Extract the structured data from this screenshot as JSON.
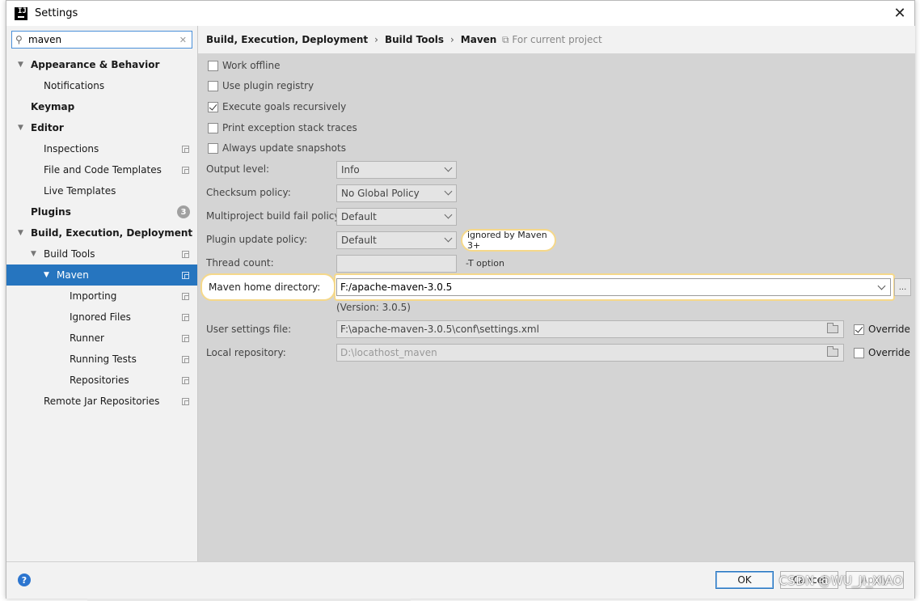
{
  "window": {
    "title": "Settings",
    "app_icon_text": "IJ"
  },
  "search": {
    "value": "maven",
    "placeholder": ""
  },
  "tree": [
    {
      "label": "Appearance & Behavior",
      "level": 0,
      "bold": true,
      "expanded": true
    },
    {
      "label": "Notifications",
      "level": 1
    },
    {
      "label": "Keymap",
      "level": 0,
      "bold": true
    },
    {
      "label": "Editor",
      "level": 0,
      "bold": true,
      "expanded": true
    },
    {
      "label": "Inspections",
      "level": 1,
      "copy": true
    },
    {
      "label": "File and Code Templates",
      "level": 1,
      "copy": true
    },
    {
      "label": "Live Templates",
      "level": 1
    },
    {
      "label": "Plugins",
      "level": 0,
      "bold": true,
      "badge": "3"
    },
    {
      "label": "Build, Execution, Deployment",
      "level": 0,
      "bold": true,
      "expanded": true
    },
    {
      "label": "Build Tools",
      "level": 1,
      "expanded": true,
      "copy": true
    },
    {
      "label": "Maven",
      "level": 2,
      "expanded": true,
      "copy": true,
      "selected": true
    },
    {
      "label": "Importing",
      "level": 3,
      "copy": true
    },
    {
      "label": "Ignored Files",
      "level": 3,
      "copy": true
    },
    {
      "label": "Runner",
      "level": 3,
      "copy": true
    },
    {
      "label": "Running Tests",
      "level": 3,
      "copy": true
    },
    {
      "label": "Repositories",
      "level": 3,
      "copy": true
    },
    {
      "label": "Remote Jar Repositories",
      "level": 1,
      "copy": true
    }
  ],
  "breadcrumb": {
    "items": [
      "Build, Execution, Deployment",
      "Build Tools",
      "Maven"
    ],
    "separator": "›",
    "scope": "For current project"
  },
  "options": {
    "work_offline": {
      "label": "Work offline",
      "checked": false
    },
    "use_plugin_registry": {
      "label": "Use plugin registry",
      "checked": false
    },
    "execute_goals": {
      "label": "Execute goals recursively",
      "checked": true
    },
    "print_exception": {
      "label": "Print exception stack traces",
      "checked": false
    },
    "always_update": {
      "label": "Always update snapshots",
      "checked": false
    }
  },
  "fields": {
    "output_level": {
      "label": "Output level:",
      "value": "Info"
    },
    "checksum_policy": {
      "label": "Checksum policy:",
      "value": "No Global Policy"
    },
    "multiproject": {
      "label": "Multiproject build fail policy:",
      "value": "Default"
    },
    "plugin_update": {
      "label": "Plugin update policy:",
      "value": "Default",
      "hint": "ignored by Maven 3+"
    },
    "thread_count": {
      "label": "Thread count:",
      "value": "",
      "hint": "-T option"
    },
    "maven_home": {
      "label": "Maven home directory:",
      "value": "F:/apache-maven-3.0.5",
      "version": "(Version: 3.0.5)",
      "browse": "..."
    },
    "user_settings": {
      "label": "User settings file:",
      "value": "F:\\apache-maven-3.0.5\\conf\\settings.xml",
      "override_label": "Override",
      "override": true
    },
    "local_repo": {
      "label": "Local repository:",
      "value": "D:\\locathost_maven",
      "override_label": "Override",
      "override": false
    }
  },
  "footer": {
    "help": "?",
    "ok": "OK",
    "cancel": "Cancel",
    "apply": "Apply",
    "watermark": "CSDN @WU_JI_XIAO"
  }
}
